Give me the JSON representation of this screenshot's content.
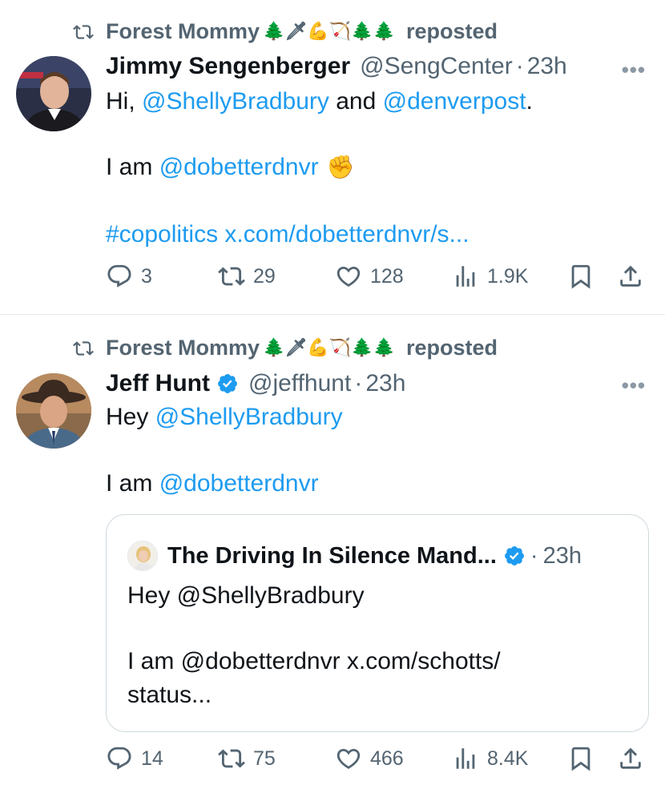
{
  "tweets": [
    {
      "repost_by": "Forest Mommy",
      "repost_emojis": "🌲🗡💪🏹🌲🌲",
      "repost_word": "reposted",
      "author": "Jimmy Sengenberger",
      "handle": "@SengCenter",
      "separator": "·",
      "time": "23h",
      "more": "•••",
      "line1": {
        "prefix": "Hi, ",
        "mention1": "@ShellyBradbury",
        "middle": " and ",
        "mention2": "@denverpost",
        "suffix": "."
      },
      "line2": {
        "prefix": "I am ",
        "mention": "@dobetterdnvr",
        "emoji": "✊"
      },
      "line3": {
        "hashtag": "#copolitics",
        "link": "x.com/dobetterdnvr/s..."
      },
      "stats": {
        "replies": "3",
        "reposts": "29",
        "likes": "128",
        "views": "1.9K"
      }
    },
    {
      "repost_by": "Forest Mommy",
      "repost_emojis": "🌲🗡💪🏹🌲🌲",
      "repost_word": "reposted",
      "author": "Jeff Hunt",
      "verified": true,
      "handle": "@jeffhunt",
      "separator": "·",
      "time": "23h",
      "more": "•••",
      "line1": {
        "prefix": "Hey ",
        "mention": "@ShellyBradbury"
      },
      "line2": {
        "prefix": "I am ",
        "mention": "@dobetterdnvr"
      },
      "quote": {
        "author": "The Driving In Silence Mand...",
        "verified": true,
        "separator": "·",
        "time": "23h",
        "line1": "Hey @ShellyBradbury",
        "line2": "I am @dobetterdnvr x.com/schotts/",
        "line3": "status..."
      },
      "stats": {
        "replies": "14",
        "reposts": "75",
        "likes": "466",
        "views": "8.4K"
      }
    }
  ],
  "colors": {
    "link": "#1d9bf0",
    "muted": "#536471",
    "text": "#0f1419",
    "verified": "#1d9bf0",
    "divider": "#e6e9ec"
  }
}
